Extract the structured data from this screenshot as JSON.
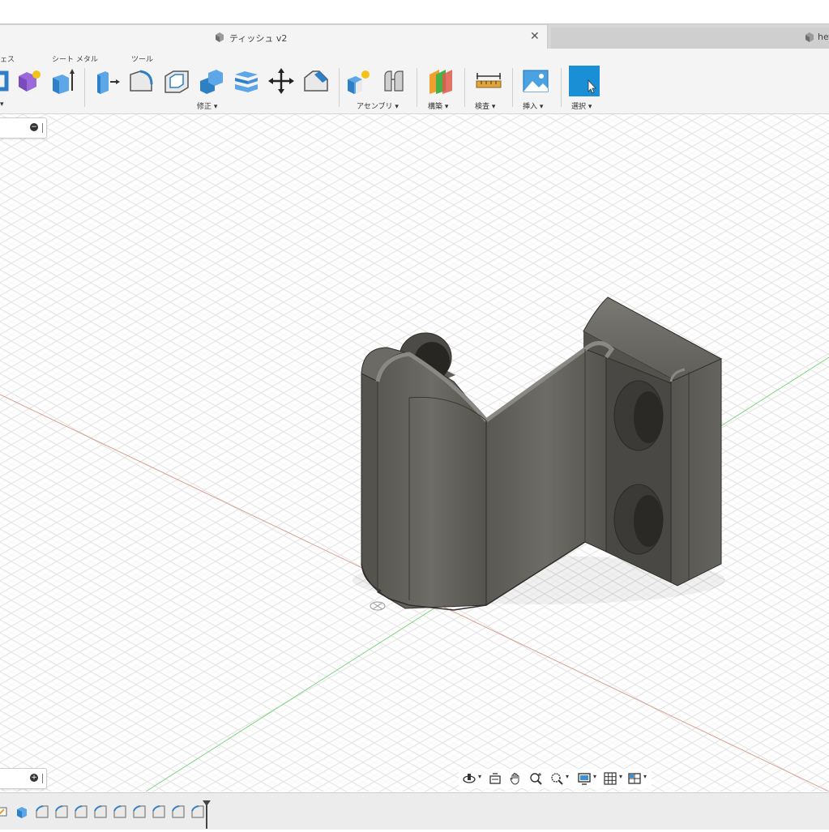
{
  "tabs": {
    "active_title": "ティッシュ v2",
    "inactive_title": "he",
    "close_glyph": "✕"
  },
  "toolbar": {
    "section_labels": {
      "surface_partial": "ェス",
      "sheet_metal": "シート メタル",
      "tools": "ツール"
    },
    "groups": {
      "create_partial": "▾",
      "modify": "修正 ▾",
      "assemble": "アセンブリ ▾",
      "construct": "構築 ▾",
      "inspect": "検査 ▾",
      "insert": "挿入 ▾",
      "select": "選択 ▾"
    },
    "icons": [
      "create-partial-icon",
      "form-icon",
      "extrude-icon",
      "press-pull-icon",
      "fillet-icon",
      "shell-icon",
      "combine-icon",
      "offset-face-icon",
      "move-icon",
      "chamfer-icon",
      "new-component-icon",
      "joint-icon",
      "offset-plane-icon",
      "measure-icon",
      "insert-image-icon",
      "select-icon"
    ]
  },
  "browser_panel": {
    "collapse_glyph": "−"
  },
  "comments_panel": {
    "expand_glyph": "+"
  },
  "navigation_bar": {
    "icons": [
      "orbit-icon",
      "look-at-icon",
      "pan-icon",
      "zoom-icon",
      "fit-icon",
      "display-settings-icon",
      "grid-settings-icon",
      "viewports-icon"
    ],
    "caret": "▾"
  },
  "timeline": {
    "icons": [
      "sketch-icon",
      "extrude-icon",
      "fillet-icon",
      "fillet-icon",
      "fillet-icon",
      "fillet-icon",
      "fillet-icon",
      "fillet-icon",
      "fillet-icon",
      "fillet-icon",
      "fillet-icon"
    ]
  },
  "colors": {
    "accent_blue": "#1a8fd6",
    "model_gray": "#5e5c57",
    "grid_line": "#e3e3e3",
    "axis_green": "#7bd67b",
    "axis_red": "#d8a08f"
  }
}
